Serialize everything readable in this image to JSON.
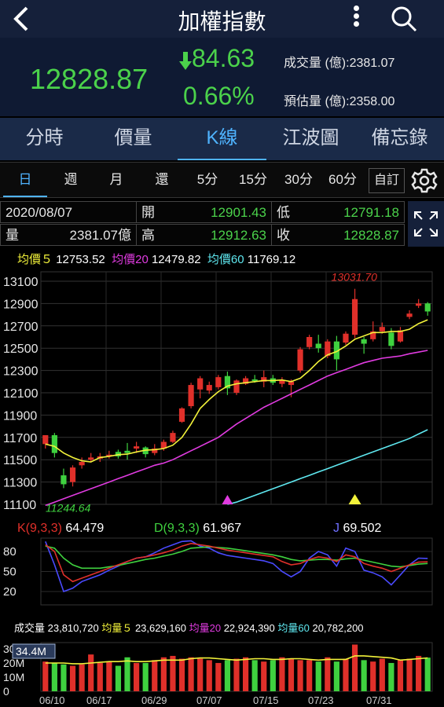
{
  "header": {
    "title": "加權指數"
  },
  "quote": {
    "price": "12828.87",
    "change": "84.63",
    "change_pct": "0.66%",
    "volume_label": "成交量 (億):",
    "volume": "2381.07",
    "est_label": "預估量 (億):",
    "est_volume": "2358.00"
  },
  "tabs": [
    "分時",
    "價量",
    "K線",
    "江波圖",
    "備忘錄"
  ],
  "active_tab": "K線",
  "periods": [
    "日",
    "週",
    "月",
    "還",
    "5分",
    "15分",
    "30分",
    "60分"
  ],
  "active_period": "日",
  "custom_label": "自訂",
  "ohlc": {
    "date": "2020/08/07",
    "open_label": "開",
    "open": "12901.43",
    "low_label": "低",
    "low": "12791.18",
    "vol_label": "量",
    "vol": "2381.07億",
    "high_label": "高",
    "high": "12912.63",
    "close_label": "收",
    "close": "12828.87"
  },
  "ma": {
    "ma5_label": "均價５",
    "ma5": "12753.52",
    "ma20_label": "均價20",
    "ma20": "12479.82",
    "ma60_label": "均價60",
    "ma60": "11769.12"
  },
  "kd": {
    "k_label": "K(9,3,3)",
    "k": "64.479",
    "d_label": "D(9,3,3)",
    "d": "61.967",
    "j_label": "J",
    "j": "69.502",
    "ticks": [
      "80",
      "50",
      "20"
    ]
  },
  "volume_panel": {
    "vol_label": "成交量",
    "vol": "23,810,720",
    "mv5_label": "均量５",
    "mv5": "23,629,160",
    "mv20_label": "均量20",
    "mv20": "22,924,390",
    "mv60_label": "均量60",
    "mv60": "20,782,200",
    "ticks": [
      "30M",
      "20M",
      "10M",
      "0"
    ],
    "max_badge": "34.4M"
  },
  "colors": {
    "up": "#e0302a",
    "down": "#3fd13f",
    "ma5": "#f2f23a",
    "ma20": "#e03be0",
    "ma60": "#5fe8f0",
    "accent": "#4fb3ff"
  },
  "chart_data": {
    "type": "candlestick",
    "y_ticks": [
      "13100",
      "12900",
      "12700",
      "12500",
      "12300",
      "12100",
      "11900",
      "11700",
      "11500",
      "11300",
      "11100"
    ],
    "ylim": [
      11100,
      13100
    ],
    "x_labels": [
      "06/10",
      "06/17",
      "06/29",
      "07/07",
      "07/15",
      "07/23",
      "07/31"
    ],
    "high_label": "13031.70",
    "low_label": "11244.64",
    "candles": [
      [
        11640,
        11720,
        11600,
        11700
      ],
      [
        11720,
        11560,
        11520,
        11740
      ],
      [
        11360,
        11280,
        11245,
        11420
      ],
      [
        11300,
        11430,
        11260,
        11450
      ],
      [
        11450,
        11480,
        11420,
        11520
      ],
      [
        11500,
        11520,
        11480,
        11560
      ],
      [
        11510,
        11530,
        11480,
        11560
      ],
      [
        11540,
        11545,
        11510,
        11580
      ],
      [
        11570,
        11530,
        11510,
        11590
      ],
      [
        11580,
        11560,
        11500,
        11650
      ],
      [
        11600,
        11620,
        11560,
        11660
      ],
      [
        11610,
        11550,
        11520,
        11620
      ],
      [
        11560,
        11600,
        11540,
        11640
      ],
      [
        11600,
        11660,
        11580,
        11680
      ],
      [
        11660,
        11740,
        11650,
        11760
      ],
      [
        11840,
        11960,
        11830,
        11970
      ],
      [
        11980,
        12170,
        11960,
        12190
      ],
      [
        12130,
        12230,
        12050,
        12250
      ],
      [
        12120,
        12170,
        12090,
        12200
      ],
      [
        12150,
        12240,
        12130,
        12260
      ],
      [
        12250,
        12140,
        12080,
        12290
      ],
      [
        12100,
        12210,
        12080,
        12220
      ],
      [
        12180,
        12230,
        12170,
        12250
      ],
      [
        12220,
        12210,
        12190,
        12260
      ],
      [
        12200,
        12240,
        12150,
        12300
      ],
      [
        12230,
        12190,
        12170,
        12260
      ],
      [
        12180,
        12210,
        12150,
        12240
      ],
      [
        12170,
        12200,
        12060,
        12220
      ],
      [
        12300,
        12490,
        12280,
        12510
      ],
      [
        12510,
        12600,
        12490,
        12620
      ],
      [
        12540,
        12500,
        12460,
        12620
      ],
      [
        12430,
        12560,
        12410,
        12580
      ],
      [
        12560,
        12400,
        12300,
        12610
      ],
      [
        12550,
        12630,
        12530,
        12650
      ],
      [
        12620,
        12940,
        12590,
        13032
      ],
      [
        12580,
        12540,
        12450,
        12600
      ],
      [
        12580,
        12650,
        12560,
        12740
      ],
      [
        12650,
        12690,
        12630,
        12730
      ],
      [
        12640,
        12520,
        12490,
        12680
      ],
      [
        12560,
        12660,
        12550,
        12690
      ],
      [
        12780,
        12810,
        12760,
        12840
      ],
      [
        12880,
        12900,
        12860,
        12940
      ],
      [
        12901,
        12829,
        12791,
        12913
      ]
    ],
    "ma5": [
      11640,
      11620,
      11560,
      11520,
      11490,
      11480,
      11520,
      11530,
      11545,
      11550,
      11570,
      11585,
      11590,
      11600,
      11630,
      11700,
      11820,
      11960,
      12040,
      12110,
      12160,
      12180,
      12190,
      12200,
      12210,
      12210,
      12215,
      12200,
      12230,
      12300,
      12380,
      12440,
      12470,
      12520,
      12580,
      12610,
      12640,
      12640,
      12650,
      12650,
      12670,
      12720,
      12754
    ],
    "ma20": [
      11090,
      11120,
      11150,
      11180,
      11210,
      11240,
      11270,
      11300,
      11330,
      11360,
      11390,
      11420,
      11450,
      11470,
      11500,
      11540,
      11580,
      11620,
      11660,
      11700,
      11760,
      11820,
      11870,
      11920,
      11970,
      12010,
      12050,
      12090,
      12130,
      12170,
      12210,
      12250,
      12280,
      12310,
      12340,
      12370,
      12390,
      12410,
      12420,
      12430,
      12450,
      12465,
      12480
    ],
    "ma60": [
      null,
      null,
      null,
      null,
      null,
      null,
      null,
      null,
      null,
      null,
      null,
      null,
      null,
      null,
      null,
      null,
      null,
      null,
      null,
      null,
      11100,
      11120,
      11150,
      11180,
      11210,
      11240,
      11270,
      11300,
      11330,
      11360,
      11390,
      11420,
      11450,
      11480,
      11510,
      11540,
      11570,
      11600,
      11630,
      11660,
      11690,
      11730,
      11769
    ],
    "kd_k": [
      90,
      80,
      45,
      35,
      40,
      45,
      50,
      55,
      60,
      65,
      70,
      72,
      75,
      78,
      82,
      88,
      92,
      90,
      88,
      85,
      82,
      80,
      78,
      76,
      74,
      72,
      65,
      60,
      62,
      68,
      72,
      70,
      65,
      75,
      72,
      62,
      58,
      55,
      50,
      55,
      60,
      64,
      64.5
    ],
    "kd_d": [
      88,
      85,
      70,
      60,
      55,
      55,
      55,
      57,
      59,
      62,
      65,
      68,
      70,
      73,
      76,
      80,
      85,
      86,
      87,
      86,
      85,
      83,
      81,
      79,
      77,
      75,
      72,
      68,
      66,
      67,
      68,
      68,
      67,
      69,
      70,
      67,
      64,
      61,
      58,
      57,
      59,
      61,
      62
    ],
    "kd_j": [
      95,
      60,
      20,
      25,
      35,
      40,
      45,
      52,
      58,
      65,
      70,
      72,
      78,
      85,
      90,
      95,
      96,
      88,
      85,
      78,
      74,
      72,
      70,
      68,
      66,
      62,
      50,
      42,
      50,
      70,
      80,
      75,
      58,
      85,
      80,
      52,
      48,
      42,
      30,
      45,
      60,
      70,
      69.5
    ],
    "volume": [
      21,
      20,
      19,
      18,
      19,
      26,
      20,
      21,
      18,
      24,
      20,
      20,
      22,
      24,
      25,
      23,
      24,
      23,
      22,
      20,
      22,
      23,
      24,
      22,
      21,
      22,
      24,
      23,
      22,
      22,
      21,
      24,
      21,
      23,
      33,
      22,
      21,
      23,
      20,
      22,
      23,
      25,
      23.8
    ],
    "vol_ma5": [
      20,
      20,
      20,
      19.5,
      19.5,
      20,
      20.5,
      21,
      21,
      21.5,
      21,
      21,
      21.5,
      22,
      22,
      22,
      23,
      23.5,
      23.5,
      23,
      22.5,
      22,
      22.5,
      23,
      23,
      22.5,
      22.5,
      23,
      23,
      22.5,
      22,
      22.5,
      22.5,
      22.5,
      25,
      25,
      24.5,
      24,
      23.5,
      22,
      22.5,
      23,
      23.6
    ]
  }
}
